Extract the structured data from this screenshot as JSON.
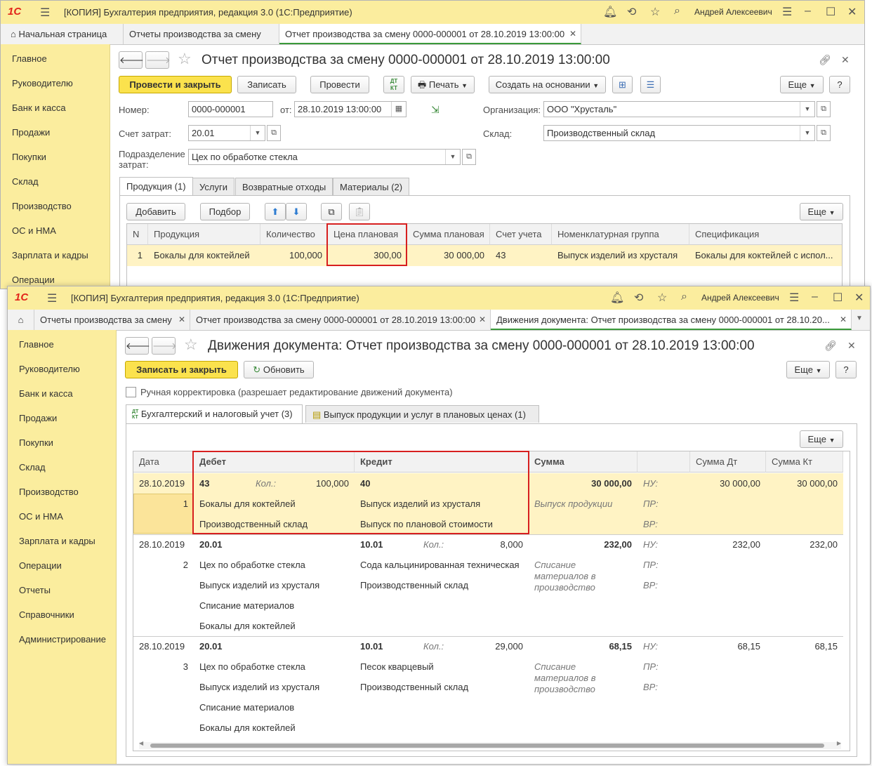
{
  "colors": {
    "title_bg": "#fbed9e",
    "accent_yellow": "#fbe24d",
    "highlight": "#d71f1f",
    "selected_row": "#fff3c4",
    "active_tab_border": "#3a9a3a"
  },
  "app_title": "[КОПИЯ] Бухгалтерия предприятия, редакция 3.0  (1С:Предприятие)",
  "logo": "1С",
  "user": "Андрей Алексеевич",
  "back_window": {
    "tabs": [
      "Начальная страница",
      "Отчеты производства за смену",
      "Отчет производства за смену 0000-000001 от 28.10.2019 13:00:00"
    ],
    "sidebar": [
      "Главное",
      "Руководителю",
      "Банк и касса",
      "Продажи",
      "Покупки",
      "Склад",
      "Производство",
      "ОС и НМА",
      "Зарплата и кадры",
      "Операции"
    ],
    "doc_title": "Отчет производства за смену 0000-000001 от 28.10.2019 13:00:00",
    "toolbar": {
      "post_close": "Провести и закрыть",
      "save": "Записать",
      "post": "Провести",
      "print": "Печать",
      "create_based": "Создать на основании",
      "more": "Еще",
      "help": "?"
    },
    "form": {
      "number_label": "Номер:",
      "number": "0000-000001",
      "date_label": "от:",
      "date": "28.10.2019 13:00:00",
      "org_label": "Организация:",
      "org": "ООО \"Хрусталь\"",
      "account_label": "Счет затрат:",
      "account": "20.01",
      "warehouse_label": "Склад:",
      "warehouse": "Производственный склад",
      "dept_label1": "Подразделение",
      "dept_label2": "затрат:",
      "dept": "Цех по обработке стекла"
    },
    "form_tabs": [
      "Продукция (1)",
      "Услуги",
      "Возвратные отходы",
      "Материалы (2)"
    ],
    "table_toolbar": {
      "add": "Добавить",
      "pick": "Подбор",
      "more": "Еще"
    },
    "columns": [
      "N",
      "Продукция",
      "Количество",
      "Цена плановая",
      "Сумма плановая",
      "Счет учета",
      "Номенклатурная группа",
      "Спецификация"
    ],
    "row": [
      "1",
      "Бокалы для коктейлей",
      "100,000",
      "300,00",
      "30 000,00",
      "43",
      "Выпуск изделий из хрусталя",
      "Бокалы для коктейлей с испол..."
    ]
  },
  "front_window": {
    "tabs": [
      "Отчеты производства за смену",
      "Отчет производства за смену 0000-000001 от 28.10.2019 13:00:00",
      "Движения документа: Отчет производства за смену 0000-000001 от 28.10.20..."
    ],
    "sidebar": [
      "Главное",
      "Руководителю",
      "Банк и касса",
      "Продажи",
      "Покупки",
      "Склад",
      "Производство",
      "ОС и НМА",
      "Зарплата и кадры",
      "Операции",
      "Отчеты",
      "Справочники",
      "Администрирование"
    ],
    "doc_title": "Движения документа: Отчет производства за смену 0000-000001 от 28.10.2019 13:00:00",
    "toolbar": {
      "save_close": "Записать и закрыть",
      "refresh": "Обновить",
      "more": "Еще",
      "help": "?"
    },
    "manual_label": "Ручная корректировка (разрешает редактирование движений документа)",
    "reg_tabs": [
      "Бухгалтерский и налоговый учет (3)",
      "Выпуск продукции и услуг в плановых ценах (1)"
    ],
    "dtkt": [
      "ДТ",
      "КТ"
    ],
    "more": "Еще",
    "columns": {
      "date": "Дата",
      "debit": "Дебет",
      "credit": "Кредит",
      "sum": "Сумма",
      "sum_dt": "Сумма Дт",
      "sum_kt": "Сумма Кт"
    },
    "qty_label": "Кол.:",
    "tax_labels": [
      "НУ:",
      "ПР:",
      "ВР:"
    ],
    "entries": [
      {
        "date": "28.10.2019",
        "n": "1",
        "debit": "43",
        "debit_qty": "100,000",
        "debit_sub": [
          "Бокалы для коктейлей",
          "Производственный склад"
        ],
        "credit": "40",
        "credit_qty": "",
        "credit_sub": [
          "Выпуск изделий из хрусталя",
          "Выпуск по плановой стоимости"
        ],
        "sum": "30 000,00",
        "content": "Выпуск продукции",
        "sum_dt": "30 000,00",
        "sum_kt": "30 000,00"
      },
      {
        "date": "28.10.2019",
        "n": "2",
        "debit": "20.01",
        "debit_qty": "",
        "debit_sub": [
          "Цех по обработке стекла",
          "Выпуск изделий из хрусталя",
          "Списание материалов",
          "Бокалы для коктейлей"
        ],
        "credit": "10.01",
        "credit_qty": "8,000",
        "credit_sub": [
          "Сода кальцинированная техническая",
          "Производственный склад"
        ],
        "sum": "232,00",
        "content": "Списание материалов в производство",
        "sum_dt": "232,00",
        "sum_kt": "232,00"
      },
      {
        "date": "28.10.2019",
        "n": "3",
        "debit": "20.01",
        "debit_qty": "",
        "debit_sub": [
          "Цех по обработке стекла",
          "Выпуск изделий из хрусталя",
          "Списание материалов",
          "Бокалы для коктейлей"
        ],
        "credit": "10.01",
        "credit_qty": "29,000",
        "credit_sub": [
          "Песок кварцевый",
          "Производственный склад"
        ],
        "sum": "68,15",
        "content": "Списание материалов в производство",
        "sum_dt": "68,15",
        "sum_kt": "68,15"
      }
    ]
  }
}
